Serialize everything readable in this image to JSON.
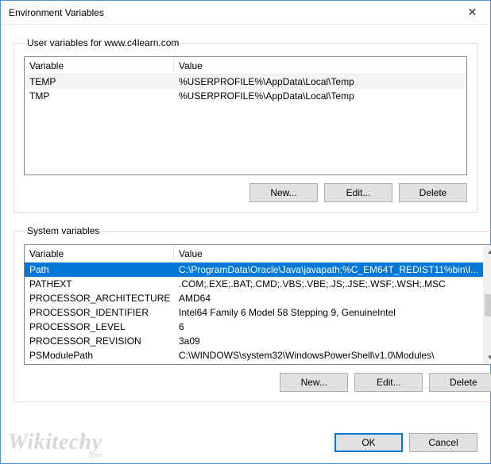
{
  "window": {
    "title": "Environment Variables",
    "close_label": "✕"
  },
  "user_group": {
    "legend": "User variables for www.c4learn.com",
    "columns": {
      "variable": "Variable",
      "value": "Value"
    },
    "rows": [
      {
        "variable": "TEMP",
        "value": "%USERPROFILE%\\AppData\\Local\\Temp"
      },
      {
        "variable": "TMP",
        "value": "%USERPROFILE%\\AppData\\Local\\Temp"
      }
    ],
    "buttons": {
      "new": "New...",
      "edit": "Edit...",
      "delete": "Delete"
    }
  },
  "system_group": {
    "legend": "System variables",
    "columns": {
      "variable": "Variable",
      "value": "Value"
    },
    "rows": [
      {
        "variable": "Path",
        "value": "C:\\ProgramData\\Oracle\\Java\\javapath;%C_EM64T_REDIST11%bin\\I...",
        "selected": true
      },
      {
        "variable": "PATHEXT",
        "value": ".COM;.EXE;.BAT;.CMD;.VBS;.VBE;.JS;.JSE;.WSF;.WSH;.MSC"
      },
      {
        "variable": "PROCESSOR_ARCHITECTURE",
        "value": "AMD64"
      },
      {
        "variable": "PROCESSOR_IDENTIFIER",
        "value": "Intel64 Family 6 Model 58 Stepping 9, GenuineIntel"
      },
      {
        "variable": "PROCESSOR_LEVEL",
        "value": "6"
      },
      {
        "variable": "PROCESSOR_REVISION",
        "value": "3a09"
      },
      {
        "variable": "PSModulePath",
        "value": "C:\\WINDOWS\\system32\\WindowsPowerShell\\v1.0\\Modules\\"
      }
    ],
    "buttons": {
      "new": "New...",
      "edit": "Edit...",
      "delete": "Delete"
    }
  },
  "footer": {
    "ok": "OK",
    "cancel": "Cancel"
  },
  "watermark": {
    "brand": "Wikitechy",
    "suffix": ".com"
  }
}
